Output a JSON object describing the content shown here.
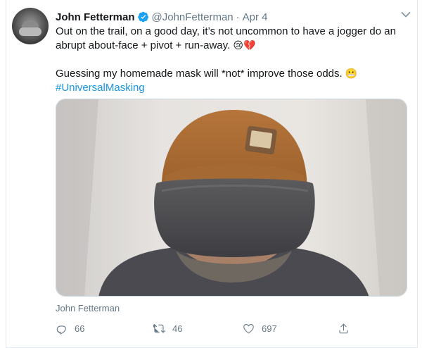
{
  "tweet": {
    "author_name": "John Fetterman",
    "handle": "@JohnFetterman",
    "separator": "·",
    "date": "Apr 4",
    "line1": "Out on the trail, on a good day, it’s not uncommon to have a jogger do an abrupt about-face + pivot  + run-away. ",
    "line1_emoji": "😢💔",
    "line2": "Guessing my homemade mask will *not* improve those odds. ",
    "line2_emoji": "😬",
    "hashtag": "#UniversalMasking",
    "media_caption": "John Fetterman",
    "counts": {
      "replies": "66",
      "retweets": "46",
      "likes": "697"
    }
  },
  "icons": {
    "verified": "verified-badge-icon",
    "more": "chevron-down-icon",
    "reply": "reply-icon",
    "retweet": "retweet-icon",
    "like": "heart-icon",
    "share": "share-icon"
  },
  "colors": {
    "link": "#1b95e0",
    "muted": "#657786",
    "text": "#14171a",
    "verified": "#1da1f2",
    "border": "#e1e8ed"
  }
}
